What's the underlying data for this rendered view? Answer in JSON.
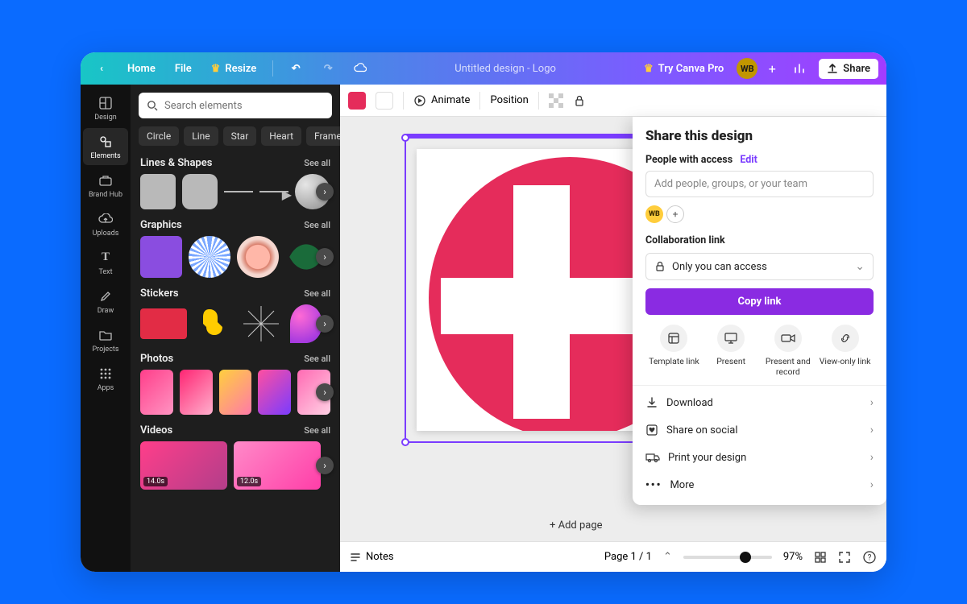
{
  "topbar": {
    "home": "Home",
    "file": "File",
    "resize": "Resize",
    "title": "Untitled design - Logo",
    "try_pro": "Try Canva Pro",
    "avatar": "WB",
    "share": "Share"
  },
  "rail": [
    {
      "label": "Design"
    },
    {
      "label": "Elements"
    },
    {
      "label": "Brand Hub"
    },
    {
      "label": "Uploads"
    },
    {
      "label": "Text"
    },
    {
      "label": "Draw"
    },
    {
      "label": "Projects"
    },
    {
      "label": "Apps"
    }
  ],
  "panel": {
    "search_placeholder": "Search elements",
    "chips": [
      "Circle",
      "Line",
      "Star",
      "Heart",
      "Frame"
    ],
    "sections": {
      "lines": {
        "title": "Lines & Shapes",
        "seeall": "See all"
      },
      "graphics": {
        "title": "Graphics",
        "seeall": "See all"
      },
      "stickers": {
        "title": "Stickers",
        "seeall": "See all"
      },
      "photos": {
        "title": "Photos",
        "seeall": "See all"
      },
      "videos": {
        "title": "Videos",
        "seeall": "See all",
        "durations": [
          "14.0s",
          "12.0s"
        ]
      }
    }
  },
  "ctx": {
    "animate": "Animate",
    "position": "Position"
  },
  "canvas": {
    "add_page": "+ Add page"
  },
  "footer": {
    "notes": "Notes",
    "page": "Page 1 / 1",
    "zoom": "97%"
  },
  "share": {
    "title": "Share this design",
    "people_label": "People with access",
    "edit": "Edit",
    "add_people_placeholder": "Add people, groups, or your team",
    "avatar": "WB",
    "collab_label": "Collaboration link",
    "access_option": "Only you can access",
    "copy": "Copy link",
    "quick": [
      {
        "label": "Template link"
      },
      {
        "label": "Present"
      },
      {
        "label": "Present and record"
      },
      {
        "label": "View-only link"
      }
    ],
    "actions": {
      "download": "Download",
      "social": "Share on social",
      "print": "Print your design",
      "more": "More"
    }
  }
}
